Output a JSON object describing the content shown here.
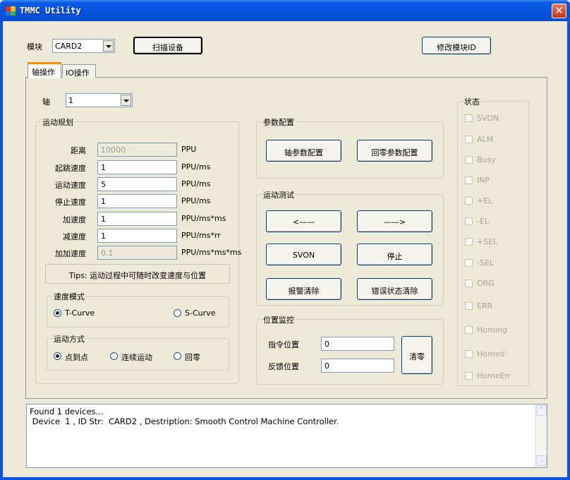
{
  "window": {
    "title": "TMMC Utility",
    "close_label": "✕"
  },
  "top": {
    "module_label": "模块",
    "module_value": "CARD2",
    "scan_label": "扫描设备",
    "modify_id_label": "修改模块ID"
  },
  "tabs": [
    "轴操作",
    "IO操作"
  ],
  "axis": {
    "label": "轴",
    "value": "1"
  },
  "motion_plan": {
    "title": "运动规划",
    "rows": [
      {
        "label": "距离",
        "value": "10000",
        "unit": "PPU",
        "disabled": true
      },
      {
        "label": "起跳速度",
        "value": "1",
        "unit": "PPU/ms",
        "disabled": false
      },
      {
        "label": "运动速度",
        "value": "5",
        "unit": "PPU/ms",
        "disabled": false
      },
      {
        "label": "停止速度",
        "value": "1",
        "unit": "PPU/ms",
        "disabled": false
      },
      {
        "label": "加速度",
        "value": "1",
        "unit": "PPU/ms*ms",
        "disabled": false
      },
      {
        "label": "减速度",
        "value": "1",
        "unit": "PPU/ms*rr",
        "disabled": false
      },
      {
        "label": "加加速度",
        "value": "0.1",
        "unit": "PPU/ms*ms*ms",
        "disabled": true
      }
    ],
    "tips": "Tips: 运动过程中可随时改变速度与位置"
  },
  "speed_mode": {
    "title": "速度模式",
    "opt1": "T-Curve",
    "opt2": "S-Curve"
  },
  "motion_mode": {
    "title": "运动方式",
    "opt1": "点到点",
    "opt2": "连续运动",
    "opt3": "回零"
  },
  "params": {
    "title": "参数配置",
    "axis_btn": "轴参数配置",
    "home_btn": "回零参数配置"
  },
  "test": {
    "title": "运动测试",
    "left_btn": "<——",
    "right_btn": "——>",
    "svon_btn": "SVON",
    "stop_btn": "停止",
    "alarm_btn": "报警清除",
    "err_btn": "错误状态清除"
  },
  "pos": {
    "title": "位置监控",
    "cmd_label": "指令位置",
    "cmd_value": "0",
    "fb_label": "反馈位置",
    "fb_value": "0",
    "clear_btn": "清零"
  },
  "status": {
    "title": "状态",
    "items": [
      "SVON",
      "ALM",
      "Busy",
      "INP",
      "+EL",
      "-EL",
      "+SEL",
      "-SEL",
      "ORG",
      "ERR",
      "Homing",
      "Homed",
      "HomeErr"
    ]
  },
  "log": {
    "line1": "Found 1 devices...",
    "line2": " Device  1 , ID Str:  CARD2 , Destription: Smooth Control Machine Controller."
  }
}
